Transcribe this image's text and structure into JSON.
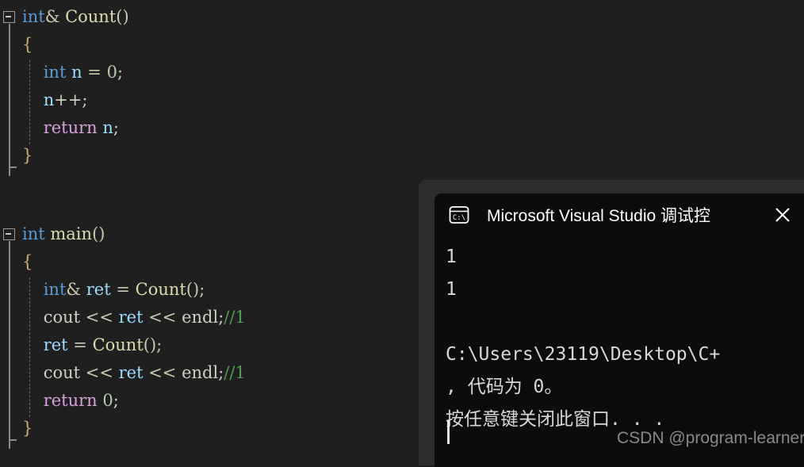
{
  "editor": {
    "background": "#1f1f1f",
    "blocks": [
      {
        "name": "count-function",
        "lines": [
          {
            "tokens": [
              {
                "t": "int",
                "c": "t-kw"
              },
              {
                "t": "& ",
                "c": "t-op"
              },
              {
                "t": "Count",
                "c": "t-fn"
              },
              {
                "t": "()",
                "c": "t-paren"
              }
            ]
          },
          {
            "tokens": [
              {
                "t": "{",
                "c": "t-brace"
              }
            ]
          },
          {
            "tokens": [
              {
                "t": "    ",
                "c": "t-plain"
              },
              {
                "t": "int",
                "c": "t-kw"
              },
              {
                "t": " ",
                "c": "t-plain"
              },
              {
                "t": "n",
                "c": "t-var"
              },
              {
                "t": " = ",
                "c": "t-op"
              },
              {
                "t": "0",
                "c": "t-num"
              },
              {
                "t": ";",
                "c": "t-plain"
              }
            ]
          },
          {
            "tokens": [
              {
                "t": "    ",
                "c": "t-plain"
              },
              {
                "t": "n",
                "c": "t-var"
              },
              {
                "t": "++;",
                "c": "t-plain"
              }
            ]
          },
          {
            "tokens": [
              {
                "t": "    ",
                "c": "t-plain"
              },
              {
                "t": "return",
                "c": "t-ret"
              },
              {
                "t": " ",
                "c": "t-plain"
              },
              {
                "t": "n",
                "c": "t-var"
              },
              {
                "t": ";",
                "c": "t-plain"
              }
            ]
          },
          {
            "tokens": [
              {
                "t": "}",
                "c": "t-brace"
              }
            ]
          }
        ]
      },
      {
        "name": "main-function",
        "lines": [
          {
            "tokens": [
              {
                "t": "int",
                "c": "t-kw"
              },
              {
                "t": " ",
                "c": "t-plain"
              },
              {
                "t": "main",
                "c": "t-fn"
              },
              {
                "t": "()",
                "c": "t-paren"
              }
            ]
          },
          {
            "tokens": [
              {
                "t": "{",
                "c": "t-brace"
              }
            ]
          },
          {
            "tokens": [
              {
                "t": "    ",
                "c": "t-plain"
              },
              {
                "t": "int",
                "c": "t-kw"
              },
              {
                "t": "& ",
                "c": "t-op"
              },
              {
                "t": "ret",
                "c": "t-var"
              },
              {
                "t": " = ",
                "c": "t-op"
              },
              {
                "t": "Count",
                "c": "t-fn"
              },
              {
                "t": "();",
                "c": "t-paren"
              }
            ]
          },
          {
            "tokens": [
              {
                "t": "    ",
                "c": "t-plain"
              },
              {
                "t": "cout",
                "c": "t-plain"
              },
              {
                "t": " << ",
                "c": "t-op"
              },
              {
                "t": "ret",
                "c": "t-var"
              },
              {
                "t": " << ",
                "c": "t-op"
              },
              {
                "t": "endl",
                "c": "t-plain"
              },
              {
                "t": ";",
                "c": "t-plain"
              },
              {
                "t": "//1",
                "c": "t-cmt"
              }
            ]
          },
          {
            "tokens": [
              {
                "t": "    ",
                "c": "t-plain"
              },
              {
                "t": "ret",
                "c": "t-var"
              },
              {
                "t": " = ",
                "c": "t-op"
              },
              {
                "t": "Count",
                "c": "t-fn"
              },
              {
                "t": "();",
                "c": "t-paren"
              }
            ]
          },
          {
            "tokens": [
              {
                "t": "    ",
                "c": "t-plain"
              },
              {
                "t": "cout",
                "c": "t-plain"
              },
              {
                "t": " << ",
                "c": "t-op"
              },
              {
                "t": "ret",
                "c": "t-var"
              },
              {
                "t": " << ",
                "c": "t-op"
              },
              {
                "t": "endl",
                "c": "t-plain"
              },
              {
                "t": ";",
                "c": "t-plain"
              },
              {
                "t": "//1",
                "c": "t-cmt"
              }
            ]
          },
          {
            "tokens": [
              {
                "t": "    ",
                "c": "t-plain"
              },
              {
                "t": "return",
                "c": "t-ret"
              },
              {
                "t": " ",
                "c": "t-plain"
              },
              {
                "t": "0",
                "c": "t-num"
              },
              {
                "t": ";",
                "c": "t-plain"
              }
            ]
          },
          {
            "tokens": [
              {
                "t": "}",
                "c": "t-brace"
              }
            ]
          }
        ]
      }
    ]
  },
  "console": {
    "title": "Microsoft Visual Studio 调试控",
    "icon_name": "console-cmd-icon",
    "icon_text": "C:\\",
    "close_label": "✕",
    "background": "#0c0c0c",
    "shell_background": "#2d2d2d",
    "output_lines": [
      "1",
      "1",
      "",
      "C:\\Users\\23119\\Desktop\\C+",
      ", 代码为 0。",
      "按任意键关闭此窗口. . ."
    ]
  },
  "watermark": {
    "text": "CSDN @program-learner"
  }
}
